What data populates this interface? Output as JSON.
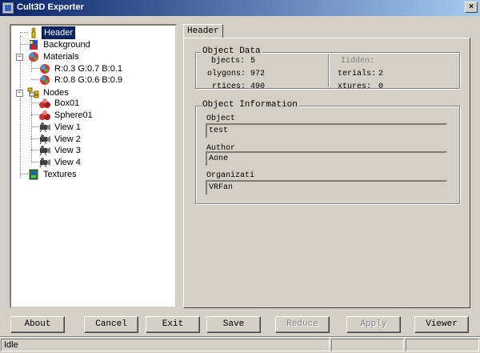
{
  "window": {
    "title": "Cult3D Exporter",
    "close": "×"
  },
  "tree": {
    "header": "Header",
    "background": "Background",
    "materials": "Materials",
    "material_items": [
      "R:0.3 G:0.7 B:0.1",
      "R:0.8 G:0.6 B:0.9"
    ],
    "nodes": "Nodes",
    "node_items": [
      "Box01",
      "Sphere01",
      "View 1",
      "View 2",
      "View 3",
      "View 4"
    ],
    "textures": "Textures",
    "expand_symbol": "−"
  },
  "tab": {
    "label": "Header"
  },
  "object_data": {
    "title": "Object Data",
    "objects_label": "bjects:",
    "objects_value": "5",
    "polygons_label": "olygons:",
    "polygons_value": "972",
    "vertices_label": "rtices:",
    "vertices_value": "490",
    "hidden_label": "Iidden:",
    "materials_label": "terials:",
    "materials_value": "2",
    "textures_label": "xtures:",
    "textures_value": "0"
  },
  "object_info": {
    "title": "Object Information",
    "object_label": "Object",
    "object_value": "test",
    "author_label": "Author",
    "author_value": "Aone",
    "org_label": "Organizati",
    "org_value": "VRFan"
  },
  "buttons": {
    "about": "About",
    "cancel": "Cancel",
    "exit": "Exit",
    "save": "Save",
    "reduce": "Reduce",
    "apply": "Apply",
    "viewer": "Viewer"
  },
  "status": {
    "text": "Idle"
  }
}
